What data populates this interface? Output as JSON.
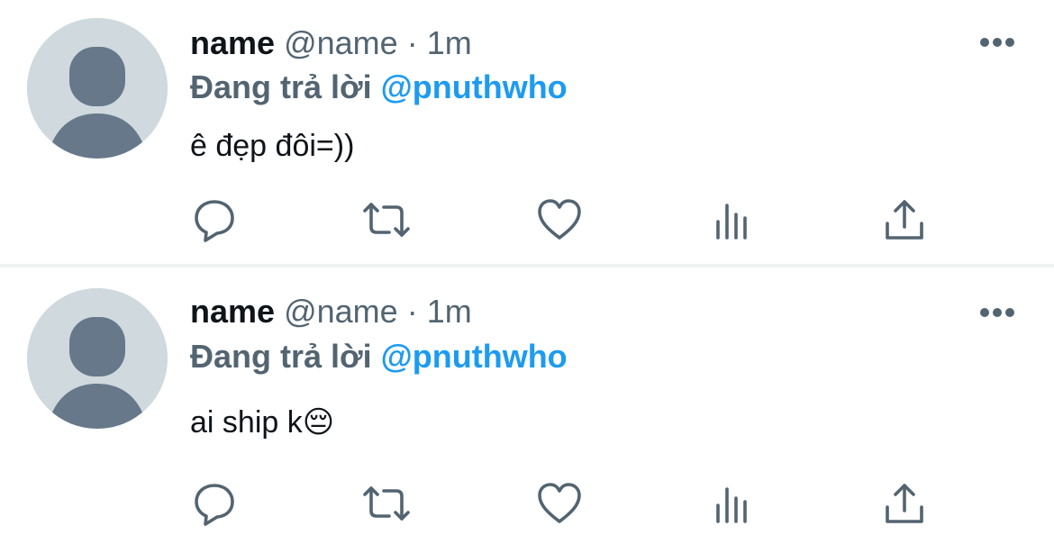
{
  "colors": {
    "text_primary": "#0f1419",
    "text_secondary": "#536471",
    "accent": "#1d9bf0",
    "avatar_bg": "#cfd9de",
    "avatar_fg": "#66788a",
    "divider": "#eff3f4"
  },
  "tweets": [
    {
      "display_name": "name",
      "handle": "@name",
      "separator": "·",
      "time": "1m",
      "reply_prefix": "Đang trả lời",
      "reply_to": "@pnuthwho",
      "text": "ê đẹp đôi=))"
    },
    {
      "display_name": "name",
      "handle": "@name",
      "separator": "·",
      "time": "1m",
      "reply_prefix": "Đang trả lời",
      "reply_to": "@pnuthwho",
      "text": "ai ship k😔"
    }
  ],
  "icons": {
    "avatar": "default-avatar-icon",
    "more": "more-options-icon",
    "reply": "reply-icon",
    "retweet": "retweet-icon",
    "like": "heart-icon",
    "views": "views-icon",
    "share": "share-icon"
  }
}
